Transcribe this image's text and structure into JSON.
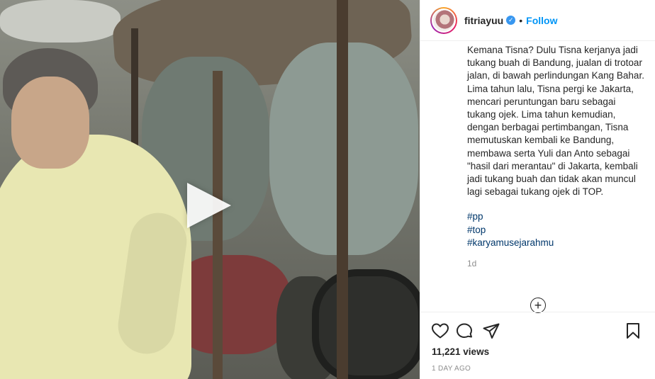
{
  "header": {
    "username": "fitriayuu",
    "verified_icon": "verified-badge-icon",
    "separator": "•",
    "follow_label": "Follow"
  },
  "post": {
    "caption": "Kemana Tisna? Dulu Tisna kerjanya jadi tukang buah di Bandung, jualan di trotoar jalan, di bawah perlindungan Kang Bahar. Lima tahun lalu, Tisna pergi ke Jakarta, mencari peruntungan baru sebagai tukang ojek. Lima tahun kemudian, dengan berbagai pertimbangan, Tisna memutuskan kembali ke Bandung, membawa serta Yuli dan Anto sebagai \"hasil dari merantau\" di Jakarta, kembali jadi tukang buah dan tidak akan muncul lagi sebagai tukang ojek di TOP.",
    "hashtags": [
      "#pp",
      "#top",
      "#karyamusejarahmu"
    ],
    "time_ago": "1d",
    "load_more_symbol": "+"
  },
  "actions": {
    "icons": [
      "heart-icon",
      "comment-icon",
      "share-icon",
      "bookmark-icon"
    ],
    "views": "11,221 views",
    "posted": "1 DAY AGO"
  },
  "colors": {
    "link": "#00376b",
    "follow": "#0095f6",
    "verified": "#3897f0",
    "muted": "#8e8e8e"
  }
}
